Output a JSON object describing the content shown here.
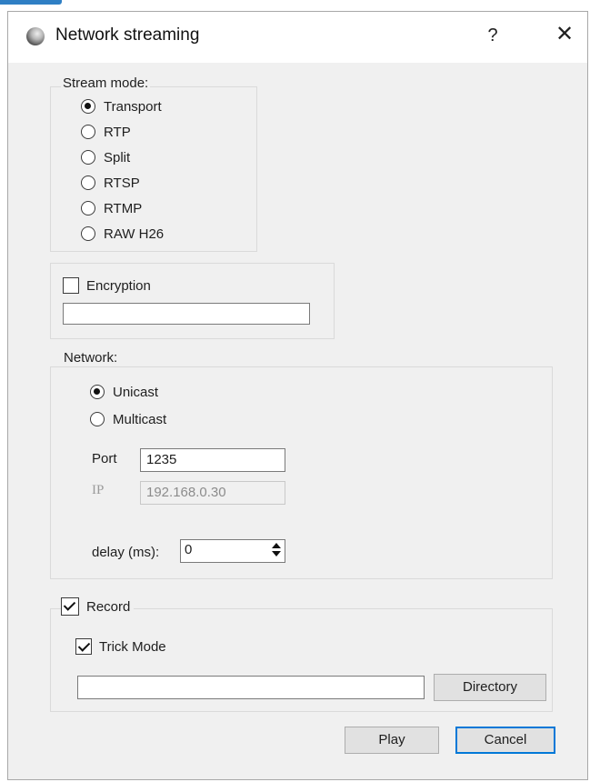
{
  "window": {
    "title": "Network streaming",
    "help": "?",
    "close": "✕"
  },
  "stream_mode": {
    "title": "Stream mode:",
    "options": [
      {
        "label": "Transport",
        "checked": true
      },
      {
        "label": "RTP",
        "checked": false
      },
      {
        "label": "Split",
        "checked": false
      },
      {
        "label": "RTSP",
        "checked": false
      },
      {
        "label": "RTMP",
        "checked": false
      },
      {
        "label": "RAW H26",
        "checked": false
      }
    ]
  },
  "encryption": {
    "label": "Encryption",
    "checked": false,
    "value": ""
  },
  "network": {
    "title": "Network:",
    "unicast": {
      "label": "Unicast",
      "checked": true
    },
    "multicast": {
      "label": "Multicast",
      "checked": false
    },
    "port_label": "Port",
    "port_value": "1235",
    "ip_label": "IP",
    "ip_value": "192.168.0.30",
    "delay_label": "delay (ms):",
    "delay_value": "0"
  },
  "record": {
    "label": "Record",
    "checked": true,
    "trick_mode_label": "Trick  Mode",
    "trick_mode_checked": true,
    "directory_value": "",
    "directory_button": "Directory"
  },
  "footer": {
    "play": "Play",
    "cancel": "Cancel"
  },
  "colors": {
    "accent": "#0078d7",
    "dialog_bg": "#f0f0f0"
  }
}
